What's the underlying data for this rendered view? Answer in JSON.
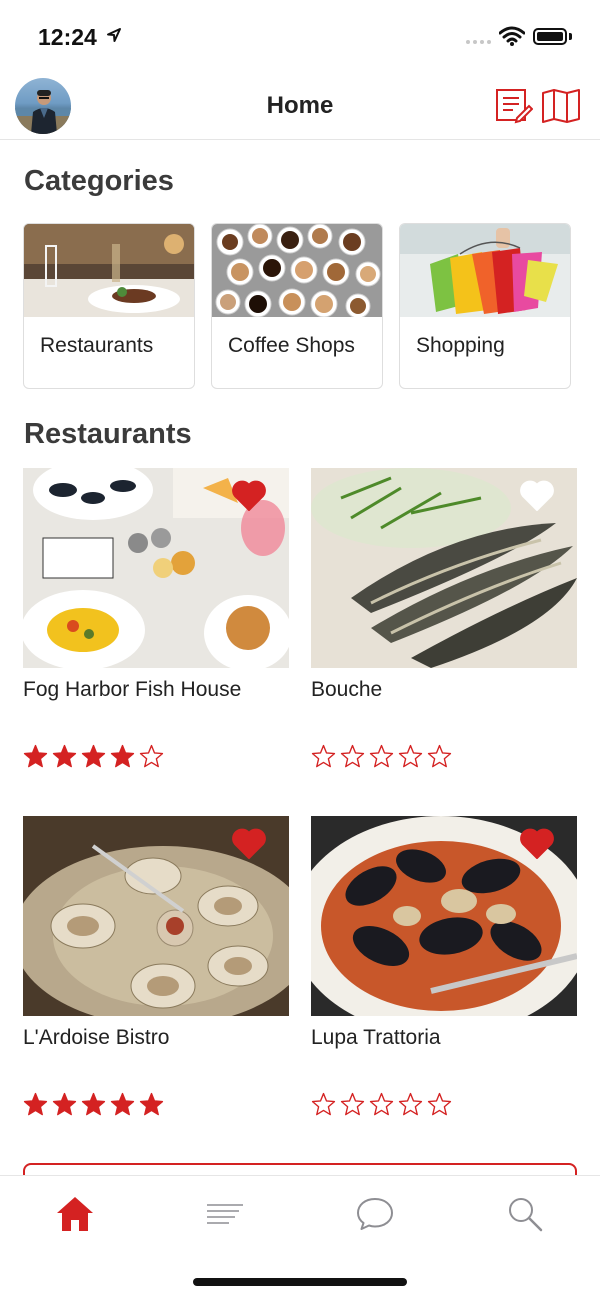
{
  "status_bar": {
    "time": "12:24"
  },
  "nav": {
    "title": "Home",
    "icons": [
      "edit-list-icon",
      "map-icon"
    ]
  },
  "categories": {
    "title": "Categories",
    "items": [
      {
        "label": "Restaurants",
        "icon": "restaurant-photo"
      },
      {
        "label": "Coffee Shops",
        "icon": "coffee-photo"
      },
      {
        "label": "Shopping",
        "icon": "shopping-photo"
      }
    ]
  },
  "restaurants": {
    "title": "Restaurants",
    "items": [
      {
        "name": "Fog Harbor Fish House",
        "rating": 4,
        "favorite": true
      },
      {
        "name": "Bouche",
        "rating": 0,
        "favorite": false
      },
      {
        "name": "L'Ardoise Bistro",
        "rating": 5,
        "favorite": true
      },
      {
        "name": "Lupa Trattoria",
        "rating": 0,
        "favorite": true
      }
    ]
  },
  "tab_bar": {
    "tabs": [
      "home-icon",
      "list-icon",
      "chat-icon",
      "search-icon"
    ],
    "active": "home-icon"
  },
  "colors": {
    "accent": "#d42222",
    "inactive": "#8e8e93",
    "text": "#222222"
  }
}
